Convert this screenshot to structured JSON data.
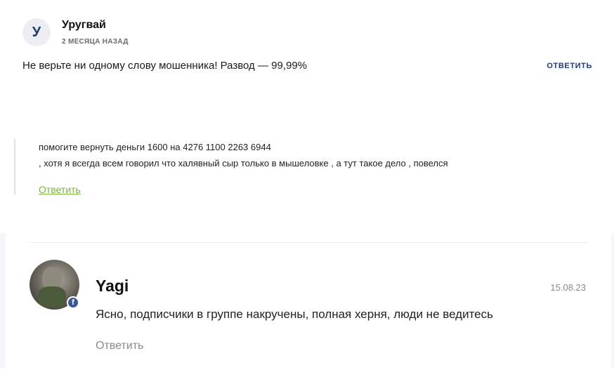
{
  "comment1": {
    "avatar_letter": "У",
    "author": "Уругвай",
    "time": "2 МЕСЯЦА НАЗАД",
    "text": "Не верьте ни одному слову мошенника! Развод — 99,99%",
    "reply_label": "ОТВЕТИТЬ"
  },
  "comment2": {
    "line1": "помогите вернуть деньги 1600 на 4276 1100 2263 6944",
    "line2": ", хотя я всегда всем говорил что халявный сыр только в мышеловке , а тут такое дело , повелся",
    "reply_label": "Ответить"
  },
  "comment3": {
    "author": "Yagi",
    "date": "15.08.23",
    "text": "Ясно, подписчики в группе накручены, полная херня, люди не ведитесь",
    "reply_label": "Ответить",
    "badge_icon": "facebook-icon",
    "badge_letter": "f",
    "badge_color": "#3b5998"
  }
}
